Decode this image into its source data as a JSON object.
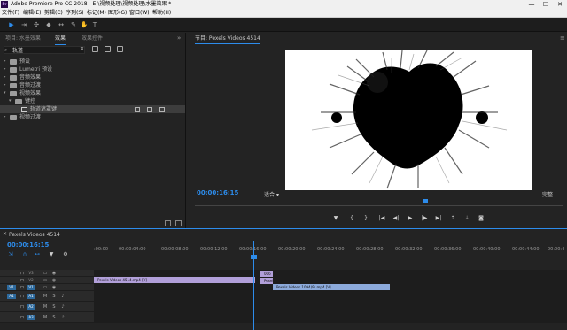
{
  "window": {
    "title": "Adobe Premiere Pro CC 2018 - E:\\视频处理\\视频处理\\水墨效果 *",
    "logo": "Pr",
    "controls": [
      "—",
      "☐",
      "✕"
    ]
  },
  "menu": [
    "文件(F)",
    "编辑(E)",
    "剪辑(C)",
    "序列(S)",
    "标记(M)",
    "图形(G)",
    "窗口(W)",
    "帮助(H)"
  ],
  "left_panel": {
    "tabs": [
      "项目: 水墨效果",
      "效果",
      "效果控件"
    ],
    "search": {
      "value": "轨道",
      "placeholder": ""
    },
    "tree": [
      {
        "label": "预设",
        "level": 0,
        "expanded": false,
        "type": "folder"
      },
      {
        "label": "Lumetri 预设",
        "level": 0,
        "expanded": false,
        "type": "folder"
      },
      {
        "label": "音频效果",
        "level": 0,
        "expanded": false,
        "type": "folder"
      },
      {
        "label": "音频过渡",
        "level": 0,
        "expanded": false,
        "type": "folder"
      },
      {
        "label": "视频效果",
        "level": 0,
        "expanded": true,
        "type": "folder"
      },
      {
        "label": "键控",
        "level": 1,
        "expanded": true,
        "type": "folder"
      },
      {
        "label": "轨道遮罩键",
        "level": 2,
        "expanded": false,
        "type": "effect",
        "selected": true
      },
      {
        "label": "视频过渡",
        "level": 0,
        "expanded": false,
        "type": "folder"
      }
    ]
  },
  "monitor": {
    "title": "节目: Pexels Videos 4514",
    "timecode": "00:00:16:15",
    "fit": "适合",
    "quality": "完整",
    "controls": [
      "marker-icon",
      "in-icon",
      "out-icon",
      "goto-in-icon",
      "step-back-icon",
      "play-icon",
      "step-forward-icon",
      "goto-out-icon",
      "lift-icon",
      "extract-icon",
      "export-frame-icon"
    ]
  },
  "timeline": {
    "title": "Pexels Videos 4514",
    "timecode": "00:00:16:15",
    "ticks": [
      ":00:00",
      "00:00:04:00",
      "00:00:08:00",
      "00:00:12:00",
      "00:00:16:00",
      "00:00:20:00",
      "00:00:24:00",
      "00:00:28:00",
      "00:00:32:00",
      "00:00:36:00",
      "00:00:40:00",
      "00:00:44:00",
      "00:00:4"
    ],
    "tracks": [
      {
        "name": "V3",
        "source": ""
      },
      {
        "name": "V2",
        "source": ""
      },
      {
        "name": "V1",
        "source": "V1"
      },
      {
        "name": "A1",
        "source": "A1"
      },
      {
        "name": "A2",
        "source": ""
      },
      {
        "name": "A3",
        "source": ""
      }
    ],
    "clips": {
      "v1a": "Pexels Videos 4514.mp4 [V]",
      "v3": "006",
      "v2": "Pexels",
      "v1b": "Pexels Videos 1094(9).mp4 [V]"
    }
  }
}
